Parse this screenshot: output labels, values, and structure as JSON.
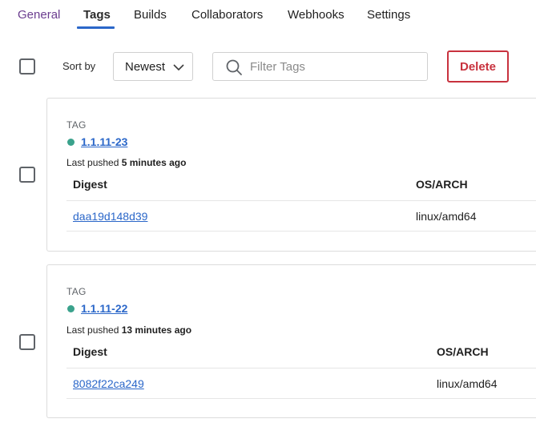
{
  "tabs": {
    "general": "General",
    "tags": "Tags",
    "builds": "Builds",
    "collaborators": "Collaborators",
    "webhooks": "Webhooks",
    "settings": "Settings"
  },
  "toolbar": {
    "sort_label": "Sort by",
    "sort_value": "Newest",
    "filter_placeholder": "Filter Tags",
    "delete_label": "Delete"
  },
  "tags": [
    {
      "heading": "TAG",
      "name": "1.1.11-23",
      "pushed_prefix": "Last pushed",
      "pushed_time": "5 minutes ago",
      "col_digest": "Digest",
      "col_osarch": "OS/ARCH",
      "digest": "daa19d148d39",
      "osarch": "linux/amd64"
    },
    {
      "heading": "TAG",
      "name": "1.1.11-22",
      "pushed_prefix": "Last pushed",
      "pushed_time": "13 minutes ago",
      "col_digest": "Digest",
      "col_osarch": "OS/ARCH",
      "digest": "8082f22ca249",
      "osarch": "linux/amd64"
    }
  ],
  "colors": {
    "accent": "#2b67c9",
    "visited": "#6b3d8f",
    "danger": "#c8323e",
    "status": "#3aa28c"
  }
}
